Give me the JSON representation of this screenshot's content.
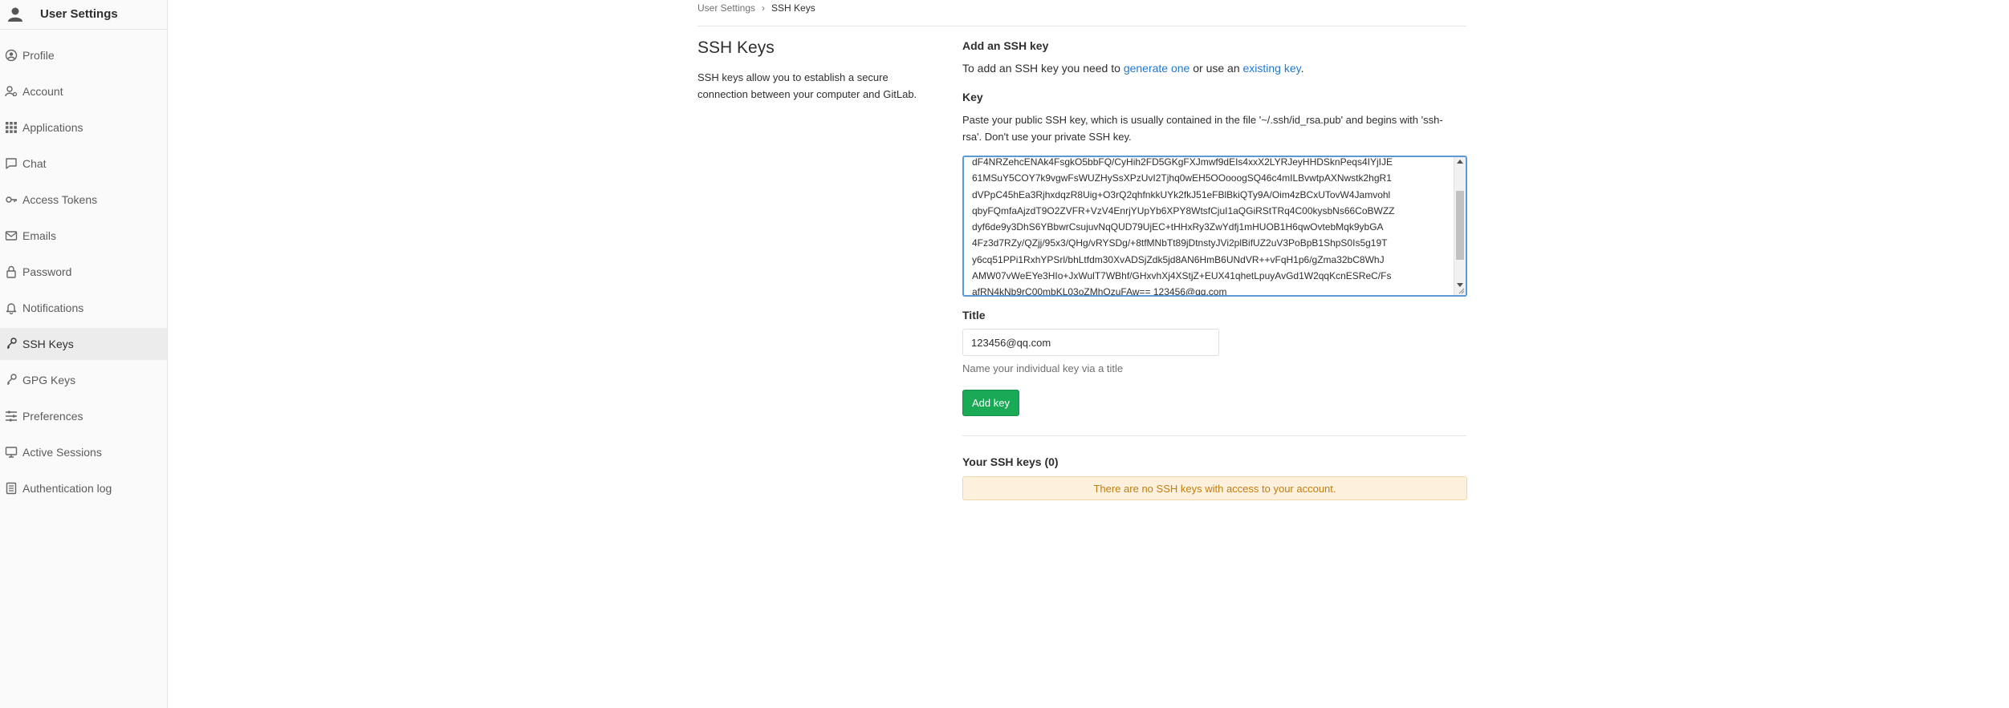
{
  "sidebar": {
    "title": "User Settings",
    "items": [
      {
        "label": "Profile",
        "icon": "profile-icon"
      },
      {
        "label": "Account",
        "icon": "account-icon"
      },
      {
        "label": "Applications",
        "icon": "applications-icon"
      },
      {
        "label": "Chat",
        "icon": "chat-icon"
      },
      {
        "label": "Access Tokens",
        "icon": "key-icon"
      },
      {
        "label": "Emails",
        "icon": "mail-icon"
      },
      {
        "label": "Password",
        "icon": "lock-icon"
      },
      {
        "label": "Notifications",
        "icon": "bell-icon"
      },
      {
        "label": "SSH Keys",
        "icon": "ssh-key-icon",
        "active": true
      },
      {
        "label": "GPG Keys",
        "icon": "gpg-key-icon"
      },
      {
        "label": "Preferences",
        "icon": "preferences-icon"
      },
      {
        "label": "Active Sessions",
        "icon": "monitor-icon"
      },
      {
        "label": "Authentication log",
        "icon": "log-icon"
      }
    ]
  },
  "breadcrumb": {
    "parent": "User Settings",
    "current": "SSH Keys"
  },
  "page": {
    "title": "SSH Keys",
    "description": "SSH keys allow you to establish a secure connection between your computer and GitLab."
  },
  "form": {
    "heading": "Add an SSH key",
    "intro_prefix": "To add an SSH key you need to ",
    "intro_link1": "generate one",
    "intro_middle": " or use an ",
    "intro_link2": "existing key",
    "intro_suffix": ".",
    "key_label": "Key",
    "key_help": "Paste your public SSH key, which is usually contained in the file '~/.ssh/id_rsa.pub' and begins with 'ssh-rsa'. Don't use your private SSH key.",
    "key_value": "dF4NRZehcENAk4FsgkO5bbFQ/CyHih2FD5GKgFXJmwf9dEIs4xxX2LYRJeyHHDSknPeqs4IYjIJE\n61MSuY5COY7k9vgwFsWUZHySsXPzUvI2Tjhq0wEH5OOooogSQ46c4mILBvwtpAXNwstk2hgR1\ndVPpC45hEa3RjhxdqzR8Uig+O3rQ2qhfnkkUYk2fkJ51eFBlBkiQTy9A/Oim4zBCxUTovW4Jamvohl\nqbyFQmfaAjzdT9O2ZVFR+VzV4EnrjYUpYb6XPY8WtsfCjuI1aQGiRStTRq4C00kysbNs66CoBWZZ\ndyf6de9y3DhS6YBbwrCsujuvNqQUD79UjEC+tHHxRy3ZwYdfj1mHUOB1H6qwOvtebMqk9ybGA\n4Fz3d7RZy/QZjj/95x3/QHg/vRYSDg/+8tfMNbTt89jDtnstyJVi2plBifUZ2uV3PoBpB1ShpS0Is5g19T\ny6cq51PPi1RxhYPSrl/bhLtfdm30XvADSjZdk5jd8AN6HmB6UNdVR++vFqH1p6/gZma32bC8WhJ\nAMW07vWeEYe3HIo+JxWulT7WBhf/GHxvhXj4XStjZ+EUX41qhetLpuyAvGd1W2qqKcnESReC/Fs\nafRN4kNb9rC00mbKL03oZMhOzuFAw== 123456@qq.com",
    "title_label": "Title",
    "title_value": "123456@qq.com",
    "title_help": "Name your individual key via a title",
    "submit_label": "Add key"
  },
  "keys_list": {
    "heading": "Your SSH keys (0)",
    "empty_message": "There are no SSH keys with access to your account."
  },
  "colors": {
    "primary_button": "#1aaa55",
    "link": "#1f78d1",
    "warning_bg": "#fdf1dd",
    "warning_text": "#c17d10",
    "focus_border": "#5b9bd5"
  }
}
